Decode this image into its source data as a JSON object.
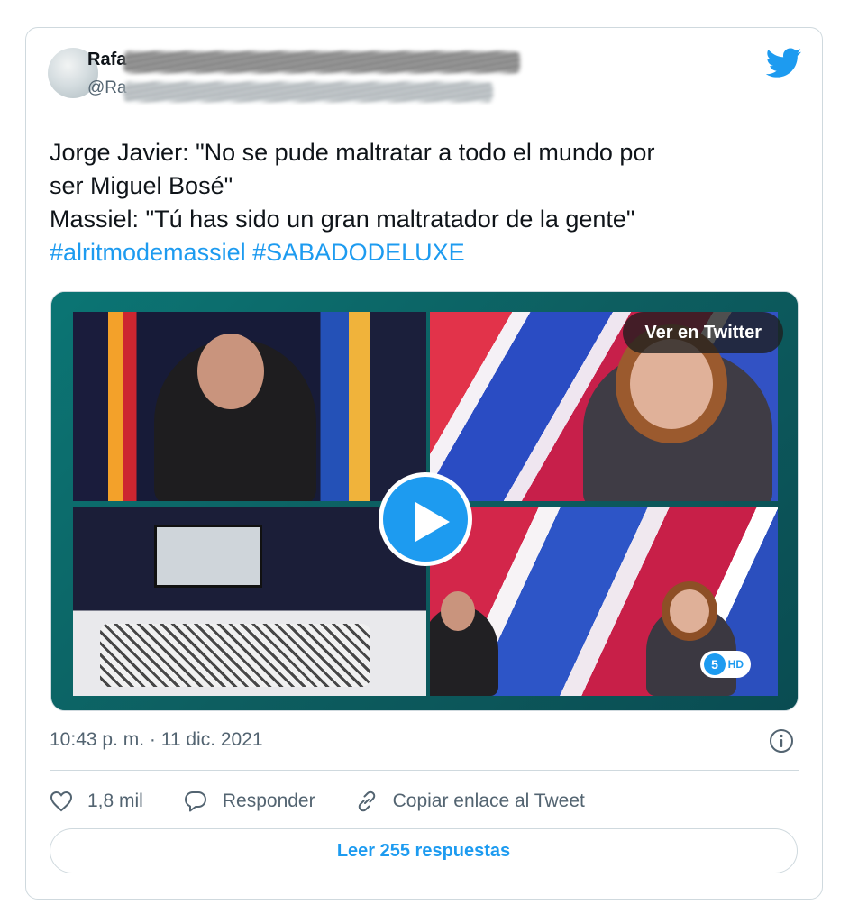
{
  "author": {
    "name": "Rafa",
    "handle": "@Ra"
  },
  "tweet": {
    "line1": "Jorge Javier: \"No se pude maltratar a todo el mundo por",
    "line2": "ser Miguel Bosé\"",
    "line3": "Massiel: \"Tú has sido un gran maltratador de la gente\"",
    "hashtags": "#alritmodemassiel #SABADODELUXE"
  },
  "media": {
    "view_on_twitter": "Ver en Twitter",
    "channel_badge": "HD",
    "channel_number": "5"
  },
  "meta": {
    "timestamp": "10:43 p. m. · 11 dic. 2021"
  },
  "actions": {
    "likes": "1,8 mil",
    "reply": "Responder",
    "copy_link": "Copiar enlace al Tweet"
  },
  "read_replies": "Leer 255 respuestas",
  "colors": {
    "accent": "#1d9bf0",
    "text": "#0f1419",
    "secondary": "#536471",
    "border": "#cfd9de"
  },
  "icons": [
    "twitter-bird-icon",
    "play-icon",
    "info-icon",
    "heart-icon",
    "reply-bubble-icon",
    "link-icon"
  ]
}
